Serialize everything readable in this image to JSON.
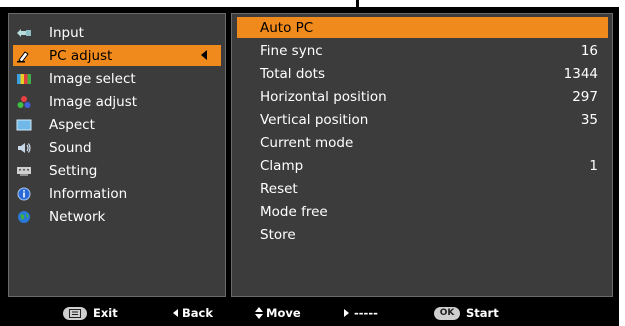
{
  "menu": {
    "items": [
      {
        "label": "Input",
        "icon": "input-icon"
      },
      {
        "label": "PC adjust",
        "icon": "pc-adjust-icon",
        "selected": true
      },
      {
        "label": "Image select",
        "icon": "image-select-icon"
      },
      {
        "label": "Image adjust",
        "icon": "image-adjust-icon"
      },
      {
        "label": "Aspect",
        "icon": "aspect-icon"
      },
      {
        "label": "Sound",
        "icon": "sound-icon"
      },
      {
        "label": "Setting",
        "icon": "setting-icon"
      },
      {
        "label": "Information",
        "icon": "information-icon"
      },
      {
        "label": "Network",
        "icon": "network-icon"
      }
    ]
  },
  "submenu": {
    "items": [
      {
        "label": "Auto PC",
        "value": "",
        "selected": true
      },
      {
        "label": "Fine sync",
        "value": "16"
      },
      {
        "label": "Total dots",
        "value": "1344"
      },
      {
        "label": "Horizontal position",
        "value": "297"
      },
      {
        "label": "Vertical position",
        "value": "35"
      },
      {
        "label": "Current mode",
        "value": ""
      },
      {
        "label": "Clamp",
        "value": "1"
      },
      {
        "label": "Reset",
        "value": ""
      },
      {
        "label": "Mode free",
        "value": ""
      },
      {
        "label": "Store",
        "value": ""
      }
    ]
  },
  "footer": {
    "exit": "Exit",
    "back": "Back",
    "move": "Move",
    "next": "-----",
    "ok_key": "OK",
    "start": "Start"
  },
  "colors": {
    "highlight": "#f08a1c",
    "panel": "#3c3c3c",
    "background": "#000000"
  }
}
